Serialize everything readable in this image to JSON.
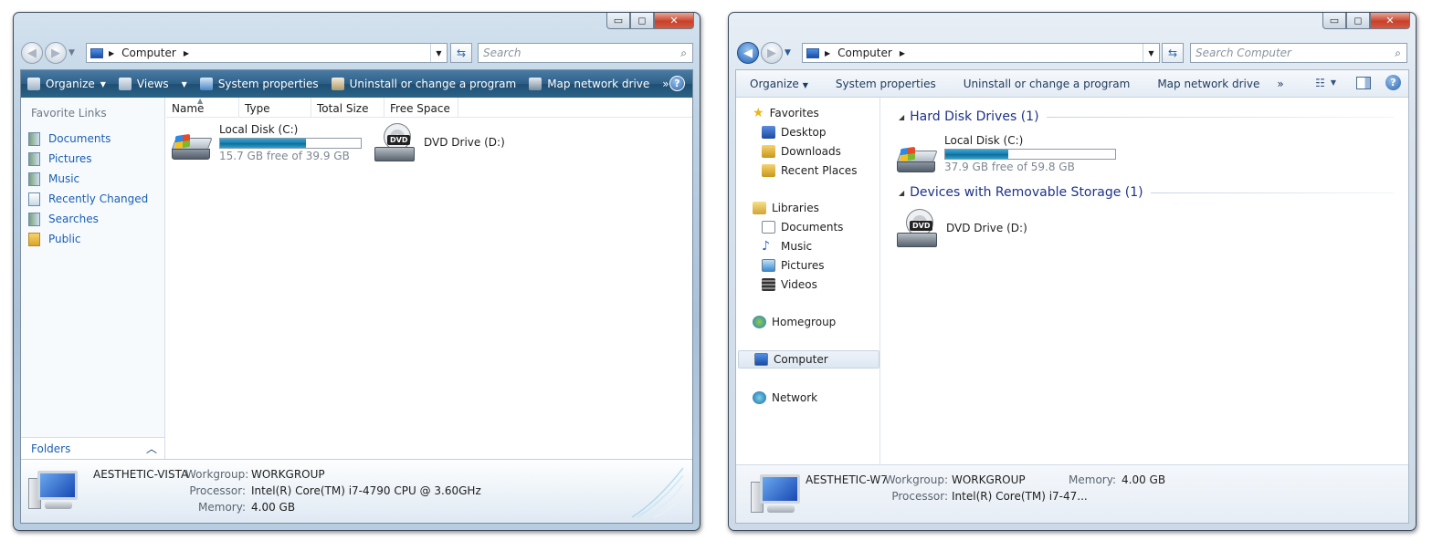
{
  "vista": {
    "caption": {
      "minimize": "▭",
      "maximize": "◻",
      "close": "✕"
    },
    "address": {
      "path": "Computer",
      "arrow": "▶"
    },
    "search_placeholder": "Search",
    "toolbar": [
      {
        "label": "Organize",
        "dropdown": true
      },
      {
        "label": "Views",
        "dropdown": true
      },
      {
        "label": "System properties",
        "dropdown": false
      },
      {
        "label": "Uninstall or change a program",
        "dropdown": false
      },
      {
        "label": "Map network drive",
        "dropdown": false
      }
    ],
    "toolbar_more": "»",
    "help": "?",
    "favorite_links_title": "Favorite Links",
    "favorite_links": [
      "Documents",
      "Pictures",
      "Music",
      "Recently Changed",
      "Searches",
      "Public"
    ],
    "folders_label": "Folders",
    "columns": [
      "Name",
      "Type",
      "Total Size",
      "Free Space"
    ],
    "drives": [
      {
        "name": "Local Disk (C:)",
        "free": "15.7 GB free of 39.9 GB",
        "used_fraction": 0.61
      },
      {
        "name": "DVD Drive (D:)",
        "badge": "DVD"
      }
    ],
    "details": {
      "computer": "AESTHETIC-VISTA",
      "workgroup_label": "Workgroup:",
      "workgroup": "WORKGROUP",
      "processor_label": "Processor:",
      "processor": "Intel(R) Core(TM) i7-4790 CPU @ 3.60GHz",
      "memory_label": "Memory:",
      "memory": "4.00 GB"
    }
  },
  "w7": {
    "caption": {
      "minimize": "▭",
      "maximize": "◻",
      "close": "✕"
    },
    "address": {
      "path": "Computer",
      "arrow": "▶"
    },
    "search_placeholder": "Search Computer",
    "toolbar": [
      {
        "label": "Organize",
        "dropdown": true
      },
      {
        "label": "System properties",
        "dropdown": false
      },
      {
        "label": "Uninstall or change a program",
        "dropdown": false
      },
      {
        "label": "Map network drive",
        "dropdown": false
      }
    ],
    "toolbar_more": "»",
    "help": "?",
    "nav": {
      "favorites": "Favorites",
      "desktop": "Desktop",
      "downloads": "Downloads",
      "recent": "Recent Places",
      "libraries": "Libraries",
      "documents": "Documents",
      "music": "Music",
      "pictures": "Pictures",
      "videos": "Videos",
      "homegroup": "Homegroup",
      "computer": "Computer",
      "network": "Network"
    },
    "groups": {
      "hdd": "Hard Disk Drives (1)",
      "removable": "Devices with Removable Storage (1)"
    },
    "drives": [
      {
        "name": "Local Disk (C:)",
        "free": "37.9 GB free of 59.8 GB",
        "used_fraction": 0.37
      },
      {
        "name": "DVD Drive (D:)",
        "badge": "DVD"
      }
    ],
    "details": {
      "computer": "AESTHETIC-W7",
      "workgroup_label": "Workgroup:",
      "workgroup": "WORKGROUP",
      "memory_label": "Memory:",
      "memory": "4.00 GB",
      "processor_label": "Processor:",
      "processor": "Intel(R) Core(TM) i7-47..."
    }
  }
}
